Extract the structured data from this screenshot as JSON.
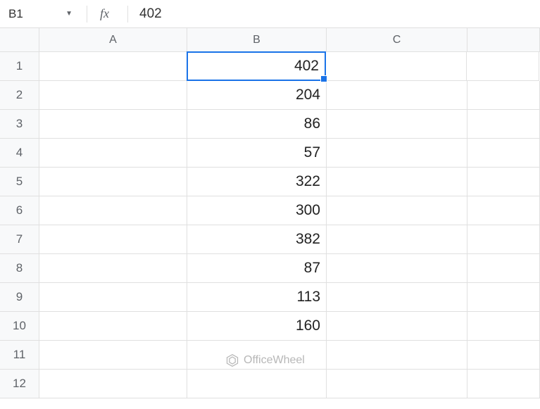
{
  "nameBox": "B1",
  "formulaValue": "402",
  "fxLabel": "fx",
  "columns": [
    "A",
    "B",
    "C"
  ],
  "rows": [
    {
      "num": "1",
      "a": "",
      "b": "402",
      "c": "",
      "selected": "b"
    },
    {
      "num": "2",
      "a": "",
      "b": "204",
      "c": ""
    },
    {
      "num": "3",
      "a": "",
      "b": "86",
      "c": ""
    },
    {
      "num": "4",
      "a": "",
      "b": "57",
      "c": ""
    },
    {
      "num": "5",
      "a": "",
      "b": "322",
      "c": ""
    },
    {
      "num": "6",
      "a": "",
      "b": "300",
      "c": ""
    },
    {
      "num": "7",
      "a": "",
      "b": "382",
      "c": ""
    },
    {
      "num": "8",
      "a": "",
      "b": "87",
      "c": ""
    },
    {
      "num": "9",
      "a": "",
      "b": "113",
      "c": ""
    },
    {
      "num": "10",
      "a": "",
      "b": "160",
      "c": ""
    },
    {
      "num": "11",
      "a": "",
      "b": "",
      "c": ""
    },
    {
      "num": "12",
      "a": "",
      "b": "",
      "c": ""
    }
  ],
  "watermark": "OfficeWheel"
}
